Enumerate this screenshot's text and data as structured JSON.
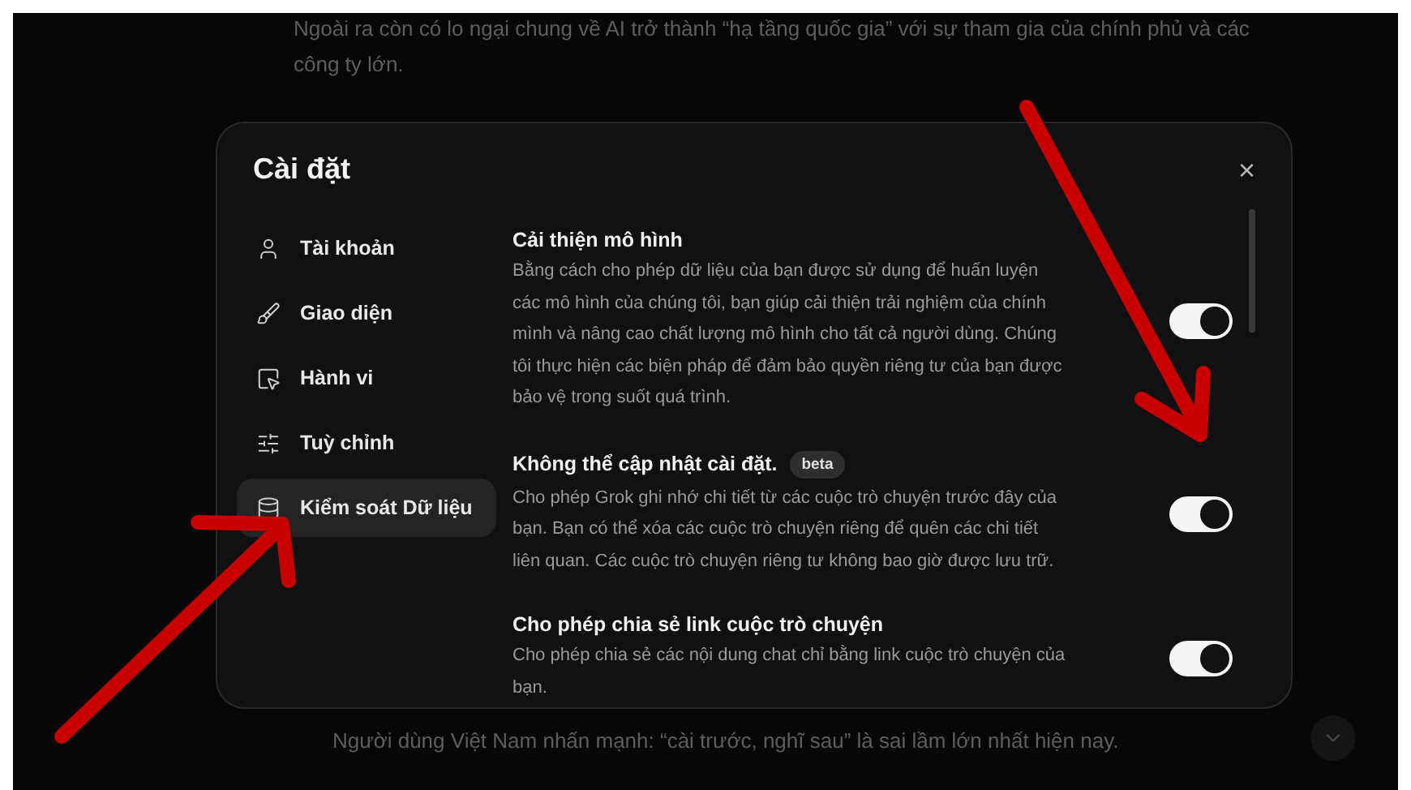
{
  "background": {
    "paragraphs": [
      "Ngoài ra còn có lo ngại chung về AI trở thành “hạ tầng quốc gia” với sự tham gia của chính phủ và các công ty lớn.",
      "Người dùng Việt Nam nhấn mạnh: “cài trước, nghĩ sau” là sai lầm lớn nhất hiện nay."
    ]
  },
  "dialog": {
    "title": "Cài đặt",
    "close": "×",
    "sidebar": {
      "items": [
        {
          "label": "Tài khoản",
          "selected": false
        },
        {
          "label": "Giao diện",
          "selected": false
        },
        {
          "label": "Hành vi",
          "selected": false
        },
        {
          "label": "Tuỳ chỉnh",
          "selected": false
        },
        {
          "label": "Kiểm soát Dữ liệu",
          "selected": true
        }
      ]
    },
    "settings": [
      {
        "title": "Cải thiện mô hình",
        "description": "Bằng cách cho phép dữ liệu của bạn được sử dụng để huấn luyện các mô hình của chúng tôi, bạn giúp cải thiện trải nghiệm của chính mình và nâng cao chất lượng mô hình cho tất cả người dùng. Chúng tôi thực hiện các biện pháp để đảm bảo quyền riêng tư của bạn được bảo vệ trong suốt quá trình.",
        "on": true
      },
      {
        "title": "Không thể cập nhật cài đặt.",
        "badge": "beta",
        "description": "Cho phép Grok ghi nhớ chi tiết từ các cuộc trò chuyện trước đây của bạn. Bạn có thể xóa các cuộc trò chuyện riêng để quên các chi tiết liên quan. Các cuộc trò chuyện riêng tư không bao giờ được lưu trữ.",
        "on": true
      },
      {
        "title": "Cho phép chia sẻ link cuộc trò chuyện",
        "description": "Cho phép chia sẻ các nội dung chat chỉ bằng link cuộc trò chuyện của bạn.",
        "on": true
      }
    ]
  }
}
